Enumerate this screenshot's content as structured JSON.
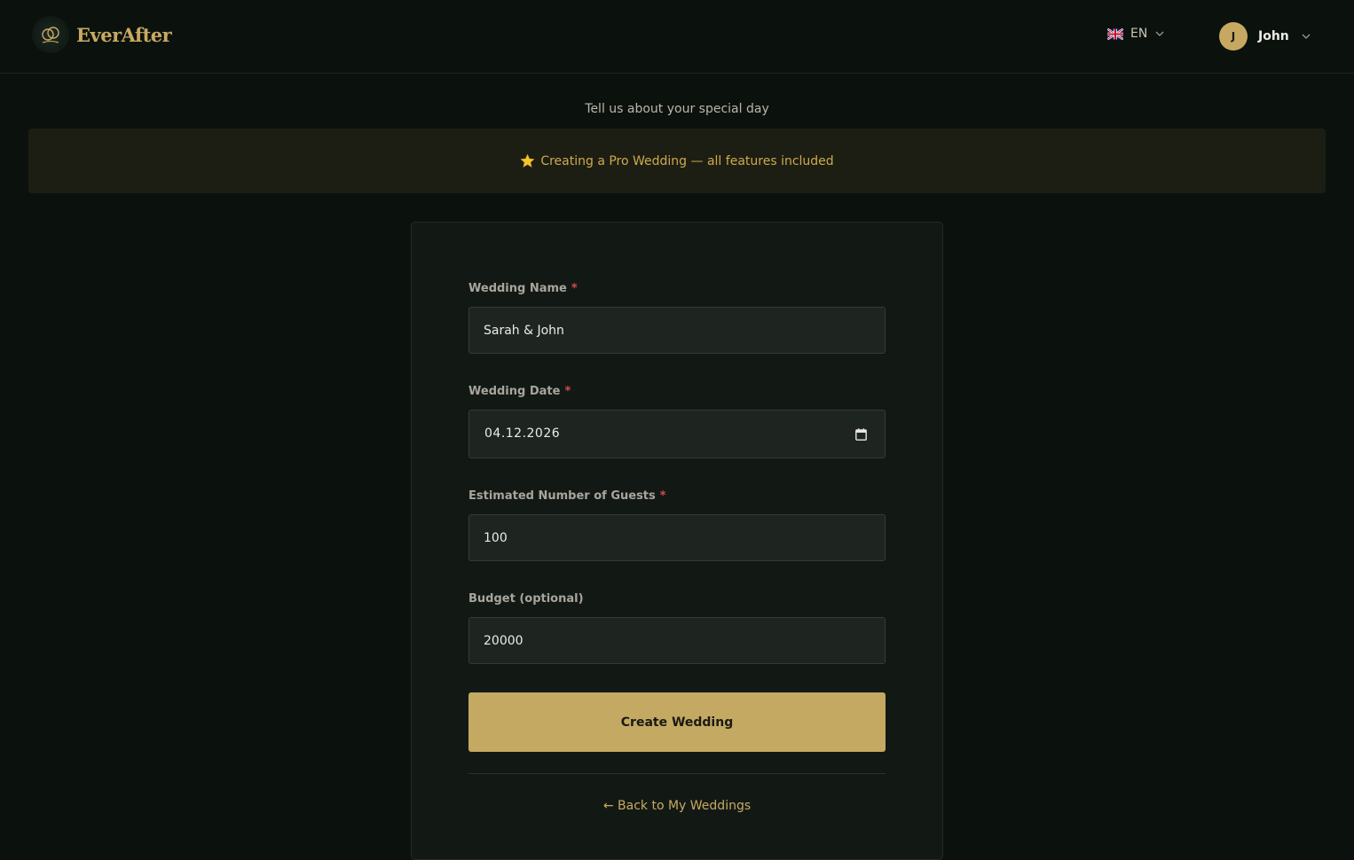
{
  "brand": {
    "name": "EverAfter"
  },
  "language": {
    "code": "EN"
  },
  "user": {
    "initial": "J",
    "name": "John"
  },
  "subtitle": "Tell us about your special day",
  "banner": {
    "text": "Creating a Pro Wedding — all features included"
  },
  "form": {
    "wedding_name": {
      "label": "Wedding Name",
      "required_mark": "*",
      "value": "Sarah & John"
    },
    "wedding_date": {
      "label": "Wedding Date",
      "required_mark": "*",
      "value": "04.12.2026"
    },
    "guests": {
      "label": "Estimated Number of Guests",
      "required_mark": "*",
      "value": "100"
    },
    "budget": {
      "label": "Budget (optional)",
      "value": "20000"
    },
    "submit_label": "Create Wedding",
    "back_label": "← Back to My Weddings"
  },
  "colors": {
    "background": "#0b120d",
    "accent": "#c4a962",
    "banner_text": "#cfa94e",
    "required": "#d24c4c"
  },
  "icons": [
    "logo-rings-icon",
    "uk-flag-icon",
    "chevron-down-icon",
    "star-icon",
    "calendar-icon"
  ]
}
